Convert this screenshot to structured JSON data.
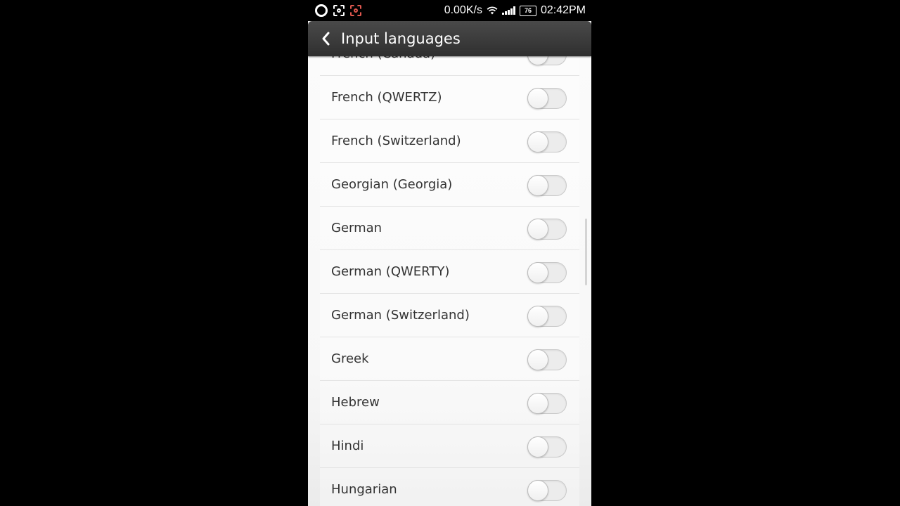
{
  "status_bar": {
    "net_speed": "0.00K/s",
    "battery": "76",
    "time": "02:42PM",
    "icons": [
      "notification-circle-icon",
      "screenshot-icon",
      "screen-record-icon",
      "wifi-icon",
      "signal-icon",
      "battery-icon"
    ]
  },
  "header": {
    "title": "Input languages",
    "back_icon": "chevron-left-icon"
  },
  "colors": {
    "toggle_on": "#2aa3e8",
    "toggle_off": "#ececec",
    "header_bg": "#3b3b3b"
  },
  "languages": [
    {
      "label": "French (Canada)",
      "enabled": false
    },
    {
      "label": "French (QWERTZ)",
      "enabled": false
    },
    {
      "label": "French (Switzerland)",
      "enabled": false
    },
    {
      "label": "Georgian (Georgia)",
      "enabled": false
    },
    {
      "label": "German",
      "enabled": false
    },
    {
      "label": "German (QWERTY)",
      "enabled": false
    },
    {
      "label": "German (Switzerland)",
      "enabled": false
    },
    {
      "label": "Greek",
      "enabled": false
    },
    {
      "label": "Hebrew",
      "enabled": false
    },
    {
      "label": "Hindi",
      "enabled": false
    },
    {
      "label": "Hungarian",
      "enabled": false
    }
  ]
}
